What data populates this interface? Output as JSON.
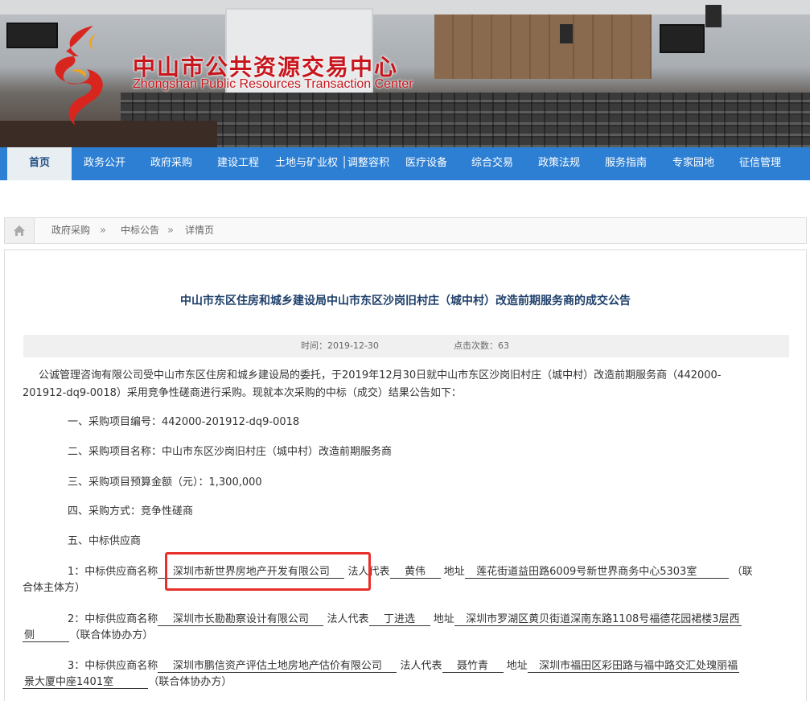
{
  "header": {
    "title_cn": "中山市公共资源交易中心",
    "title_en": "Zhongshan Public Resources Transaction Center"
  },
  "nav": {
    "items": [
      {
        "label": "首页"
      },
      {
        "label": "政务公开"
      },
      {
        "label": "政府采购"
      },
      {
        "label": "建设工程"
      },
      {
        "label": "土地与矿业权 │调整容积率"
      },
      {
        "label": "医疗设备"
      },
      {
        "label": "综合交易"
      },
      {
        "label": "政策法规"
      },
      {
        "label": "服务指南"
      },
      {
        "label": "专家园地"
      },
      {
        "label": "征信管理"
      }
    ]
  },
  "breadcrumb": {
    "items": [
      "政府采购",
      "中标公告",
      "详情页"
    ],
    "separator": "»"
  },
  "article": {
    "title": "中山市东区住房和城乡建设局中山市东区沙岗旧村庄（城中村）改造前期服务商的成交公告",
    "time_label": "时间：2019-12-30",
    "views_label": "点击次数：63",
    "intro_line1": "公诚管理咨询有限公司受中山市东区住房和城乡建设局的委托，于2019年12月30日就中山市东区沙岗旧村庄（城中村）改造前期服务商（442000-",
    "intro_line2": "201912-dq9-0018）采用竞争性磋商进行采购。现就本次采购的中标（成交）结果公告如下：",
    "item1": "一、采购项目编号：442000-201912-dq9-0018",
    "item2": "二、采购项目名称：中山市东区沙岗旧村庄（城中村）改造前期服务商",
    "item3": "三、采购项目预算金额（元）：1,300,000",
    "item4": "四、采购方式：竞争性磋商",
    "item5": "五、中标供应商",
    "s1": {
      "prefix": "1：中标供应商名称",
      "name": "深圳市新世界房地产开发有限公司",
      "rep_label": "法人代表",
      "rep": "黄伟",
      "addr_label": "地址",
      "addr": "莲花街道益田路6009号新世界商务中心5303室",
      "role_a": "（联",
      "role_b": "合体主体方）"
    },
    "s2": {
      "prefix": "2：中标供应商名称",
      "name": "深圳市长勘勘察设计有限公司",
      "rep_label": "法人代表",
      "rep": "丁进选",
      "addr_label": "地址",
      "addr": "深圳市罗湖区黄贝街道深南东路1108号福德花园裙楼3层西",
      "addr2": "侧",
      "role": "（联合体协办方）"
    },
    "s3": {
      "prefix": "3：中标供应商名称",
      "name": "深圳市鹏信资产评估土地房地产估价有限公司",
      "rep_label": "法人代表",
      "rep": "聂竹青",
      "addr_label": "地址",
      "addr": "深圳市福田区彩田路与福中路交汇处瑰丽福",
      "addr2": "景大厦中座1401室",
      "role": "（联合体协办方）"
    }
  },
  "colors": {
    "nav_bg": "#2d7fd3",
    "brand_red": "#c8161d",
    "highlight": "#e8302b",
    "title": "#1e3f6a"
  }
}
